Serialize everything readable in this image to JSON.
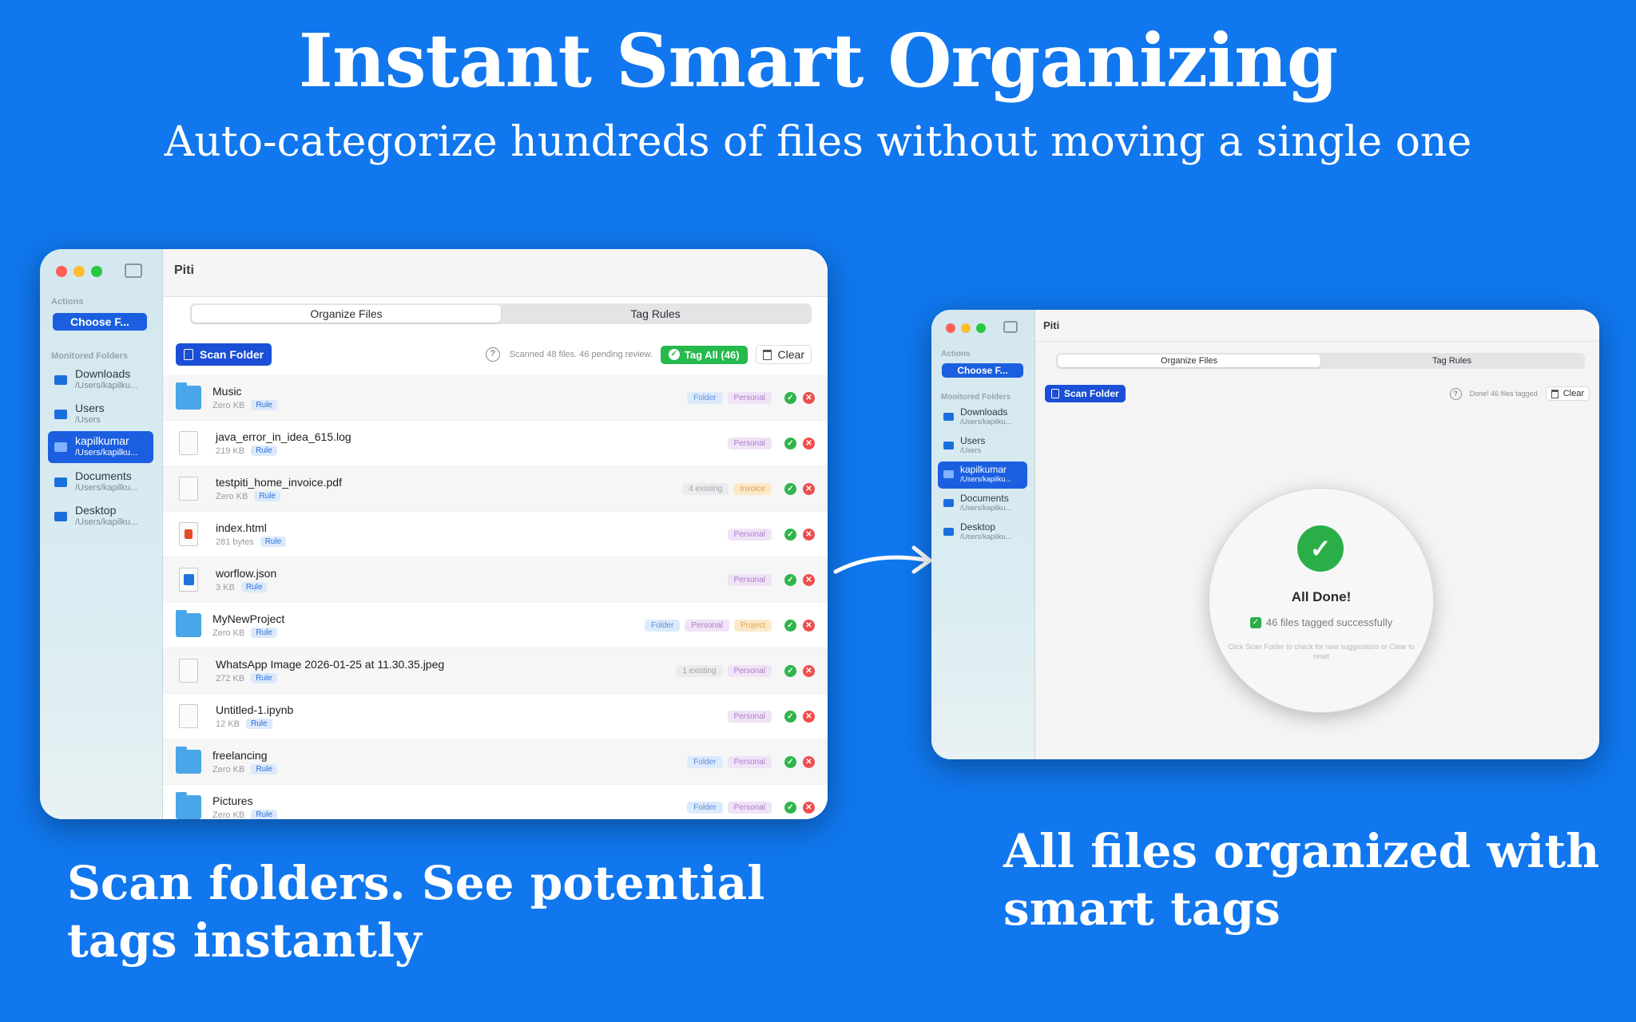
{
  "hero": {
    "title": "Instant Smart Organizing",
    "subtitle": "Auto-categorize hundreds of files without moving a single one"
  },
  "captions": {
    "left": "Scan folders. See potential tags instantly",
    "right": "All files organized with smart tags"
  },
  "app": {
    "title": "Piti",
    "actions_header": "Actions",
    "choose_label": "Choose F...",
    "monitored_header": "Monitored Folders",
    "folders": [
      {
        "name": "Downloads",
        "path": "/Users/kapilku..."
      },
      {
        "name": "Users",
        "path": "/Users"
      },
      {
        "name": "kapilkumar",
        "path": "/Users/kapilku..."
      },
      {
        "name": "Documents",
        "path": "/Users/kapilku..."
      },
      {
        "name": "Desktop",
        "path": "/Users/kapilku..."
      }
    ],
    "tabs": [
      "Organize Files",
      "Tag Rules"
    ],
    "scan_label": "Scan Folder",
    "help": "?",
    "clear_label": "Clear"
  },
  "left_window": {
    "status": "Scanned 48 files. 46 pending review.",
    "tag_all": "Tag All (46)",
    "files": [
      {
        "name": "Music",
        "size": "Zero KB",
        "rule": "Rule",
        "tags": [
          "Folder",
          "Personal"
        ]
      },
      {
        "name": "java_error_in_idea_615.log",
        "size": "219 KB",
        "rule": "Rule",
        "tags": [
          "Personal"
        ]
      },
      {
        "name": "testpiti_home_invoice.pdf",
        "size": "Zero KB",
        "rule": "Rule",
        "tags": [
          "4 existing",
          "Invoice"
        ]
      },
      {
        "name": "index.html",
        "size": "281 bytes",
        "rule": "Rule",
        "tags": [
          "Personal"
        ]
      },
      {
        "name": "worflow.json",
        "size": "3 KB",
        "rule": "Rule",
        "tags": [
          "Personal"
        ]
      },
      {
        "name": "MyNewProject",
        "size": "Zero KB",
        "rule": "Rule",
        "tags": [
          "Folder",
          "Personal",
          "Project"
        ]
      },
      {
        "name": "WhatsApp Image 2026-01-25 at 11.30.35.jpeg",
        "size": "272 KB",
        "rule": "Rule",
        "tags": [
          "1 existing",
          "Personal"
        ]
      },
      {
        "name": "Untitled-1.ipynb",
        "size": "12 KB",
        "rule": "Rule",
        "tags": [
          "Personal"
        ]
      },
      {
        "name": "freelancing",
        "size": "Zero KB",
        "rule": "Rule",
        "tags": [
          "Folder",
          "Personal"
        ]
      },
      {
        "name": "Pictures",
        "size": "Zero KB",
        "rule": "Rule",
        "tags": [
          "Folder",
          "Personal"
        ]
      }
    ]
  },
  "right_window": {
    "status": "Done! 46 files tagged",
    "done_title": "All Done!",
    "done_line": "46 files tagged successfully",
    "done_hint": "Click Scan Folder to check for new suggestions or Clear to reset"
  },
  "colors": {
    "background": "#1077ee",
    "accent": "#1b4fd6",
    "success": "#26b94c",
    "danger": "#ef4d4d"
  }
}
